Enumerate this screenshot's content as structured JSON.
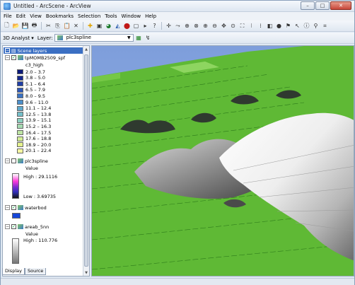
{
  "window": {
    "title": "Untitled - ArcScene - ArcView",
    "controls": {
      "minimize": "–",
      "maximize": "□",
      "close": "✕"
    }
  },
  "menu": [
    "File",
    "Edit",
    "View",
    "Bookmarks",
    "Selection",
    "Tools",
    "Window",
    "Help"
  ],
  "toolbar2": {
    "analyst_label": "3D Analyst ▾",
    "layer_label": "Layer:",
    "layer_value": "plc3spline"
  },
  "toc": {
    "root": "Scene layers",
    "layers": [
      {
        "name": "tpMOMB2509_spf",
        "checked": true,
        "field": "c3_high",
        "classes": [
          {
            "label": "2.0 – 3.7",
            "color": "#0b1a7a"
          },
          {
            "label": "3.8 – 5.0",
            "color": "#14288f"
          },
          {
            "label": "5.1 – 6.4",
            "color": "#1f3ea6"
          },
          {
            "label": "6.5 – 7.9",
            "color": "#2c57b8"
          },
          {
            "label": "8.0 – 9.5",
            "color": "#3a72c3"
          },
          {
            "label": "9.6 – 11.0",
            "color": "#4b8fcb"
          },
          {
            "label": "11.1 – 12.4",
            "color": "#5fa9cd"
          },
          {
            "label": "12.5 – 13.8",
            "color": "#74bfc9"
          },
          {
            "label": "13.9 – 15.1",
            "color": "#8dd0c0"
          },
          {
            "label": "15.2 – 16.3",
            "color": "#a6dbb2"
          },
          {
            "label": "16.4 – 17.5",
            "color": "#bde4a3"
          },
          {
            "label": "17.6 – 18.8",
            "color": "#d2ec96"
          },
          {
            "label": "18.9 – 20.0",
            "color": "#e5f28d"
          },
          {
            "label": "20.1 – 22.4",
            "color": "#f6f8a2"
          }
        ]
      },
      {
        "name": "plc3spline",
        "checked": false,
        "value_label": "Value",
        "high": "High : 29.1116",
        "low": "Low : 3.69735"
      },
      {
        "name": "waterbod",
        "checked": true,
        "color": "#1546d8"
      },
      {
        "name": "areab_5nn",
        "checked": true,
        "value_label": "Value",
        "high": "High : 110.776"
      }
    ]
  },
  "tabs": [
    "Display",
    "Source"
  ],
  "colors": {
    "scene_sky": "#86a6e0",
    "land": "#5fb935",
    "selection": "#3b6fc3"
  },
  "icons": [
    "arcscene-app-icon",
    "new-icon",
    "open-icon",
    "save-icon",
    "print-icon",
    "cut-icon",
    "copy-icon",
    "paste-icon",
    "delete-icon",
    "add-data-icon",
    "navigate-icon",
    "fly-icon",
    "zoom-in-icon",
    "zoom-out-icon",
    "pan-icon",
    "full-extent-icon",
    "identify-icon",
    "help-icon"
  ]
}
